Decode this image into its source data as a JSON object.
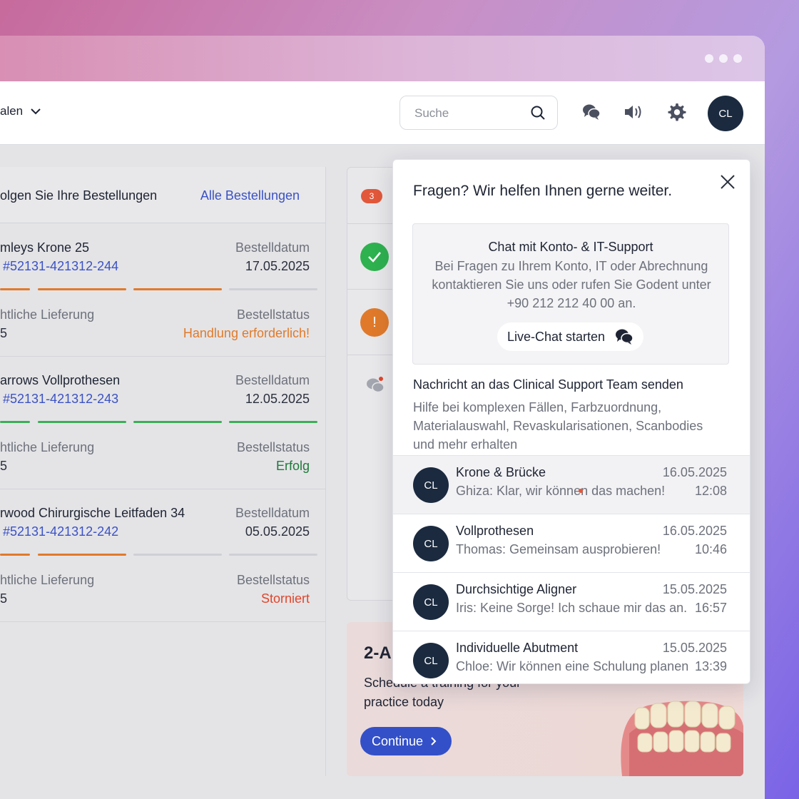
{
  "header": {
    "nav_label": "alen",
    "search_placeholder": "Suche",
    "avatar_initials": "CL"
  },
  "orders": {
    "title": "olgen Sie Ihre Bestellungen",
    "all_link": "Alle Bestellungen",
    "items": [
      {
        "name": "mleys Krone 25",
        "number": "#52131-421312-244",
        "date_label": "Bestelldatum",
        "date": "17.05.2025",
        "shipping_label": "htliche Lieferung",
        "shipping_value": "5",
        "status_label": "Bestellstatus",
        "status": "Handlung erforderlich!",
        "status_color": "#e07a2a",
        "progress_steps_done": 3,
        "progress_color": "#e07a2a"
      },
      {
        "name": "arrows Vollprothesen",
        "number": "#52131-421312-243",
        "date_label": "Bestelldatum",
        "date": "12.05.2025",
        "shipping_label": "htliche Lieferung",
        "shipping_value": "5",
        "status_label": "Bestellstatus",
        "status": "Erfolg",
        "status_color": "#1f7a3a",
        "progress_steps_done": 4,
        "progress_color": "#3cae57"
      },
      {
        "name": "rwood Chirurgische Leitfaden 34",
        "number": "#52131-421312-242",
        "date_label": "Bestelldatum",
        "date": "05.05.2025",
        "shipping_label": "htliche Lieferung",
        "shipping_value": "5",
        "status_label": "Bestellstatus",
        "status": "Storniert",
        "status_color": "#e2452a",
        "progress_steps_done": 2,
        "progress_color": "#e07a2a"
      }
    ]
  },
  "notifications": {
    "badge_count": "3"
  },
  "promo": {
    "title": "2-A",
    "text": "Schedule a training for your practice today",
    "button_label": "Continue"
  },
  "chat": {
    "heading": "Fragen? Wir helfen Ihnen gerne weiter.",
    "support_title": "Chat mit Konto- & IT-Support",
    "support_desc": "Bei Fragen zu Ihrem Konto, IT oder Abrechnung kontaktieren Sie uns oder rufen Sie Godent unter +90 212 212 40 00 an.",
    "live_chat_label": "Live-Chat starten",
    "cst_title": "Nachricht an das Clinical Support Team senden",
    "cst_desc": "Hilfe bei komplexen Fällen, Farbzuordnung, Materialauswahl, Revaskularisationen, Scanbodies und mehr erhalten",
    "conversations": [
      {
        "initials": "CL",
        "title": "Krone & Brücke",
        "date": "16.05.2025",
        "message": "Ghiza: Klar, wir können das machen!",
        "time": "12:08",
        "unread": true
      },
      {
        "initials": "CL",
        "title": "Vollprothesen",
        "date": "16.05.2025",
        "message": "Thomas: Gemeinsam ausprobieren!",
        "time": "10:46",
        "unread": false
      },
      {
        "initials": "CL",
        "title": "Durchsichtige Aligner",
        "date": "15.05.2025",
        "message": "Iris: Keine Sorge! Ich schaue mir das an.",
        "time": "16:57",
        "unread": false
      },
      {
        "initials": "CL",
        "title": "Individuelle Abutment",
        "date": "15.05.2025",
        "message": "Chloe: Wir können eine Schulung planen",
        "time": "13:39",
        "unread": false
      }
    ]
  }
}
